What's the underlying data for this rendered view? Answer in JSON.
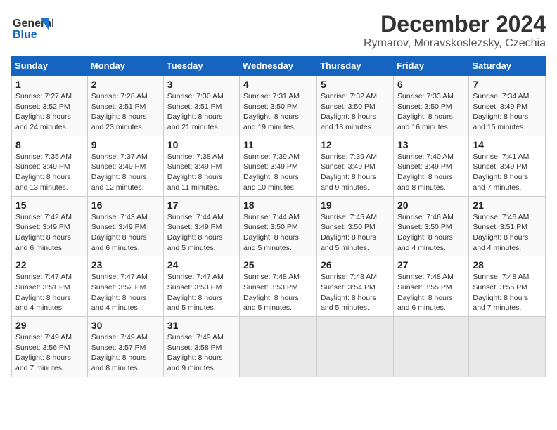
{
  "header": {
    "logo_line1": "General",
    "logo_line2": "Blue",
    "title": "December 2024",
    "subtitle": "Rymarov, Moravskoslezsky, Czechia"
  },
  "days_of_week": [
    "Sunday",
    "Monday",
    "Tuesday",
    "Wednesday",
    "Thursday",
    "Friday",
    "Saturday"
  ],
  "weeks": [
    [
      {
        "day": "1",
        "sunrise": "Sunrise: 7:27 AM",
        "sunset": "Sunset: 3:52 PM",
        "daylight": "Daylight: 8 hours and 24 minutes."
      },
      {
        "day": "2",
        "sunrise": "Sunrise: 7:28 AM",
        "sunset": "Sunset: 3:51 PM",
        "daylight": "Daylight: 8 hours and 23 minutes."
      },
      {
        "day": "3",
        "sunrise": "Sunrise: 7:30 AM",
        "sunset": "Sunset: 3:51 PM",
        "daylight": "Daylight: 8 hours and 21 minutes."
      },
      {
        "day": "4",
        "sunrise": "Sunrise: 7:31 AM",
        "sunset": "Sunset: 3:50 PM",
        "daylight": "Daylight: 8 hours and 19 minutes."
      },
      {
        "day": "5",
        "sunrise": "Sunrise: 7:32 AM",
        "sunset": "Sunset: 3:50 PM",
        "daylight": "Daylight: 8 hours and 18 minutes."
      },
      {
        "day": "6",
        "sunrise": "Sunrise: 7:33 AM",
        "sunset": "Sunset: 3:50 PM",
        "daylight": "Daylight: 8 hours and 16 minutes."
      },
      {
        "day": "7",
        "sunrise": "Sunrise: 7:34 AM",
        "sunset": "Sunset: 3:49 PM",
        "daylight": "Daylight: 8 hours and 15 minutes."
      }
    ],
    [
      {
        "day": "8",
        "sunrise": "Sunrise: 7:35 AM",
        "sunset": "Sunset: 3:49 PM",
        "daylight": "Daylight: 8 hours and 13 minutes."
      },
      {
        "day": "9",
        "sunrise": "Sunrise: 7:37 AM",
        "sunset": "Sunset: 3:49 PM",
        "daylight": "Daylight: 8 hours and 12 minutes."
      },
      {
        "day": "10",
        "sunrise": "Sunrise: 7:38 AM",
        "sunset": "Sunset: 3:49 PM",
        "daylight": "Daylight: 8 hours and 11 minutes."
      },
      {
        "day": "11",
        "sunrise": "Sunrise: 7:39 AM",
        "sunset": "Sunset: 3:49 PM",
        "daylight": "Daylight: 8 hours and 10 minutes."
      },
      {
        "day": "12",
        "sunrise": "Sunrise: 7:39 AM",
        "sunset": "Sunset: 3:49 PM",
        "daylight": "Daylight: 8 hours and 9 minutes."
      },
      {
        "day": "13",
        "sunrise": "Sunrise: 7:40 AM",
        "sunset": "Sunset: 3:49 PM",
        "daylight": "Daylight: 8 hours and 8 minutes."
      },
      {
        "day": "14",
        "sunrise": "Sunrise: 7:41 AM",
        "sunset": "Sunset: 3:49 PM",
        "daylight": "Daylight: 8 hours and 7 minutes."
      }
    ],
    [
      {
        "day": "15",
        "sunrise": "Sunrise: 7:42 AM",
        "sunset": "Sunset: 3:49 PM",
        "daylight": "Daylight: 8 hours and 6 minutes."
      },
      {
        "day": "16",
        "sunrise": "Sunrise: 7:43 AM",
        "sunset": "Sunset: 3:49 PM",
        "daylight": "Daylight: 8 hours and 6 minutes."
      },
      {
        "day": "17",
        "sunrise": "Sunrise: 7:44 AM",
        "sunset": "Sunset: 3:49 PM",
        "daylight": "Daylight: 8 hours and 5 minutes."
      },
      {
        "day": "18",
        "sunrise": "Sunrise: 7:44 AM",
        "sunset": "Sunset: 3:50 PM",
        "daylight": "Daylight: 8 hours and 5 minutes."
      },
      {
        "day": "19",
        "sunrise": "Sunrise: 7:45 AM",
        "sunset": "Sunset: 3:50 PM",
        "daylight": "Daylight: 8 hours and 5 minutes."
      },
      {
        "day": "20",
        "sunrise": "Sunrise: 7:46 AM",
        "sunset": "Sunset: 3:50 PM",
        "daylight": "Daylight: 8 hours and 4 minutes."
      },
      {
        "day": "21",
        "sunrise": "Sunrise: 7:46 AM",
        "sunset": "Sunset: 3:51 PM",
        "daylight": "Daylight: 8 hours and 4 minutes."
      }
    ],
    [
      {
        "day": "22",
        "sunrise": "Sunrise: 7:47 AM",
        "sunset": "Sunset: 3:51 PM",
        "daylight": "Daylight: 8 hours and 4 minutes."
      },
      {
        "day": "23",
        "sunrise": "Sunrise: 7:47 AM",
        "sunset": "Sunset: 3:52 PM",
        "daylight": "Daylight: 8 hours and 4 minutes."
      },
      {
        "day": "24",
        "sunrise": "Sunrise: 7:47 AM",
        "sunset": "Sunset: 3:53 PM",
        "daylight": "Daylight: 8 hours and 5 minutes."
      },
      {
        "day": "25",
        "sunrise": "Sunrise: 7:48 AM",
        "sunset": "Sunset: 3:53 PM",
        "daylight": "Daylight: 8 hours and 5 minutes."
      },
      {
        "day": "26",
        "sunrise": "Sunrise: 7:48 AM",
        "sunset": "Sunset: 3:54 PM",
        "daylight": "Daylight: 8 hours and 5 minutes."
      },
      {
        "day": "27",
        "sunrise": "Sunrise: 7:48 AM",
        "sunset": "Sunset: 3:55 PM",
        "daylight": "Daylight: 8 hours and 6 minutes."
      },
      {
        "day": "28",
        "sunrise": "Sunrise: 7:48 AM",
        "sunset": "Sunset: 3:55 PM",
        "daylight": "Daylight: 8 hours and 7 minutes."
      }
    ],
    [
      {
        "day": "29",
        "sunrise": "Sunrise: 7:49 AM",
        "sunset": "Sunset: 3:56 PM",
        "daylight": "Daylight: 8 hours and 7 minutes."
      },
      {
        "day": "30",
        "sunrise": "Sunrise: 7:49 AM",
        "sunset": "Sunset: 3:57 PM",
        "daylight": "Daylight: 8 hours and 8 minutes."
      },
      {
        "day": "31",
        "sunrise": "Sunrise: 7:49 AM",
        "sunset": "Sunset: 3:58 PM",
        "daylight": "Daylight: 8 hours and 9 minutes."
      },
      null,
      null,
      null,
      null
    ]
  ]
}
